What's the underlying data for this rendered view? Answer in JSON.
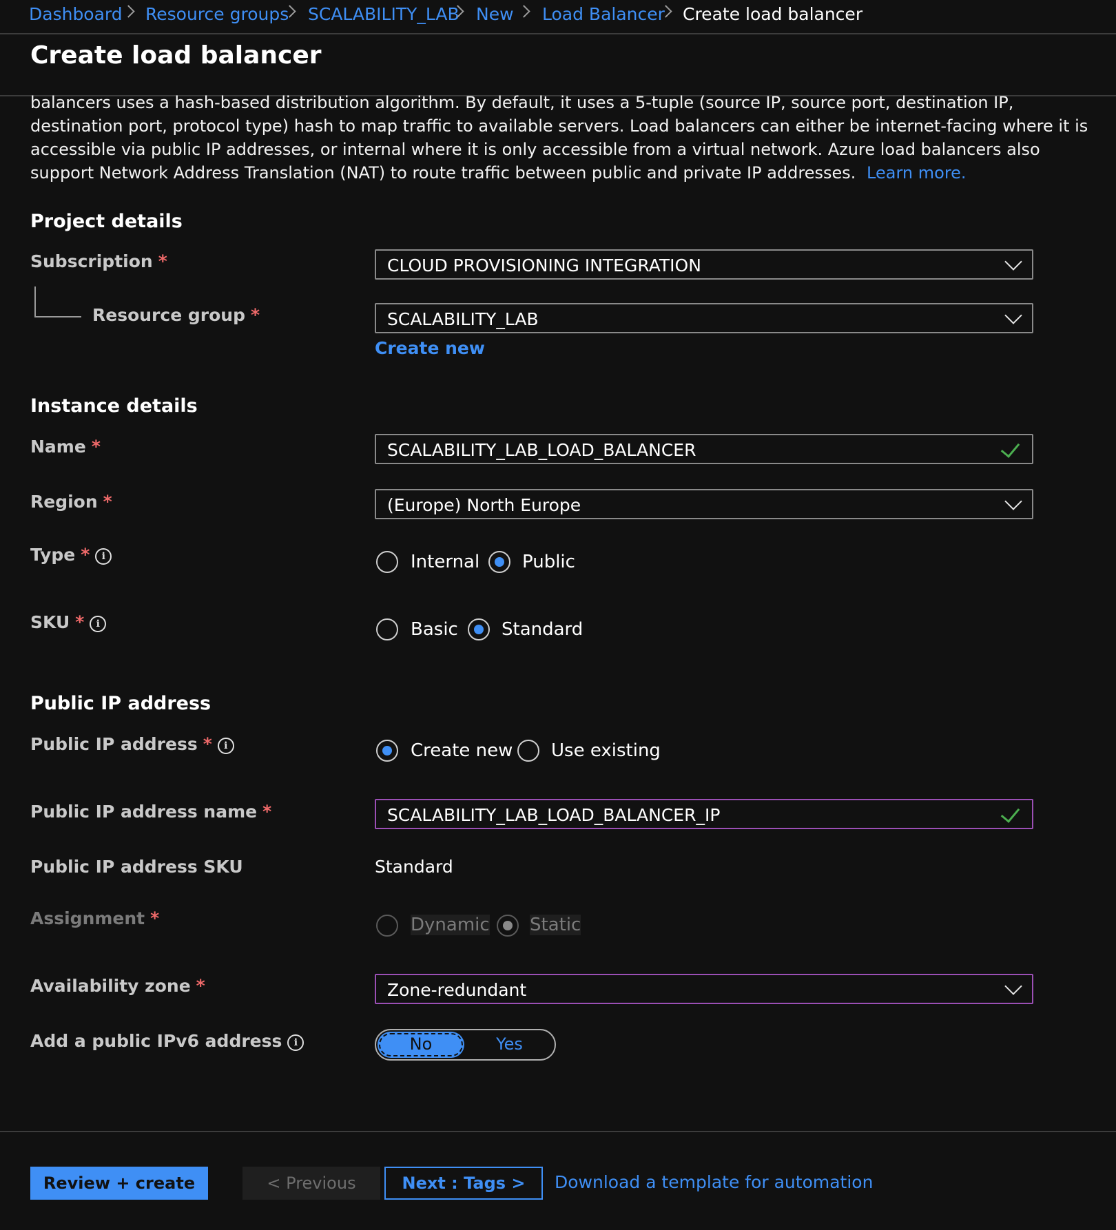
{
  "breadcrumb": {
    "items": [
      "Dashboard",
      "Resource groups",
      "SCALABILITY_LAB",
      "New",
      "Load Balancer"
    ],
    "current": "Create load balancer"
  },
  "page": {
    "title": "Create load balancer"
  },
  "intro": {
    "line1": "balancers uses a hash-based distribution algorithm. By default, it uses a 5-tuple (source IP, source port, destination IP,",
    "line2": "destination port, protocol type) hash to map traffic to available servers. Load balancers can either be internet-facing where it is",
    "line3": "accessible via public IP addresses, or internal where it is only accessible from a virtual network. Azure load balancers also",
    "line4": "support Network Address Translation (NAT) to route traffic between public and private IP addresses.",
    "learn_more": "Learn more."
  },
  "project": {
    "heading": "Project details",
    "subscription_label": "Subscription",
    "subscription_value": "CLOUD PROVISIONING INTEGRATION",
    "resource_group_label": "Resource group",
    "resource_group_value": "SCALABILITY_LAB",
    "create_new": "Create new"
  },
  "instance": {
    "heading": "Instance details",
    "name_label": "Name",
    "name_value": "SCALABILITY_LAB_LOAD_BALANCER",
    "region_label": "Region",
    "region_value": "(Europe) North Europe",
    "type_label": "Type",
    "type_options": [
      "Internal",
      "Public"
    ],
    "type_selected": "Public",
    "sku_label": "SKU",
    "sku_options": [
      "Basic",
      "Standard"
    ],
    "sku_selected": "Standard"
  },
  "public_ip": {
    "heading": "Public IP address",
    "address_label": "Public IP address",
    "address_options": [
      "Create new",
      "Use existing"
    ],
    "address_selected": "Create new",
    "name_label": "Public IP address name",
    "name_value": "SCALABILITY_LAB_LOAD_BALANCER_IP",
    "sku_label": "Public IP address SKU",
    "sku_value": "Standard",
    "assignment_label": "Assignment",
    "assignment_options": [
      "Dynamic",
      "Static"
    ],
    "assignment_selected": "Static",
    "zone_label": "Availability zone",
    "zone_value": "Zone-redundant",
    "ipv6_label": "Add a public IPv6 address",
    "ipv6_options": [
      "No",
      "Yes"
    ],
    "ipv6_selected": "No"
  },
  "footer": {
    "review_create": "Review + create",
    "previous": "< Previous",
    "next": "Next : Tags >",
    "download": "Download a template for automation"
  },
  "required_mark": "*",
  "info_glyph": "i",
  "colors": {
    "accent": "#3f8ff5",
    "required": "#f06a6a",
    "valid": "#4caf50",
    "focus_border": "#9b4fb5",
    "background": "#111111"
  }
}
